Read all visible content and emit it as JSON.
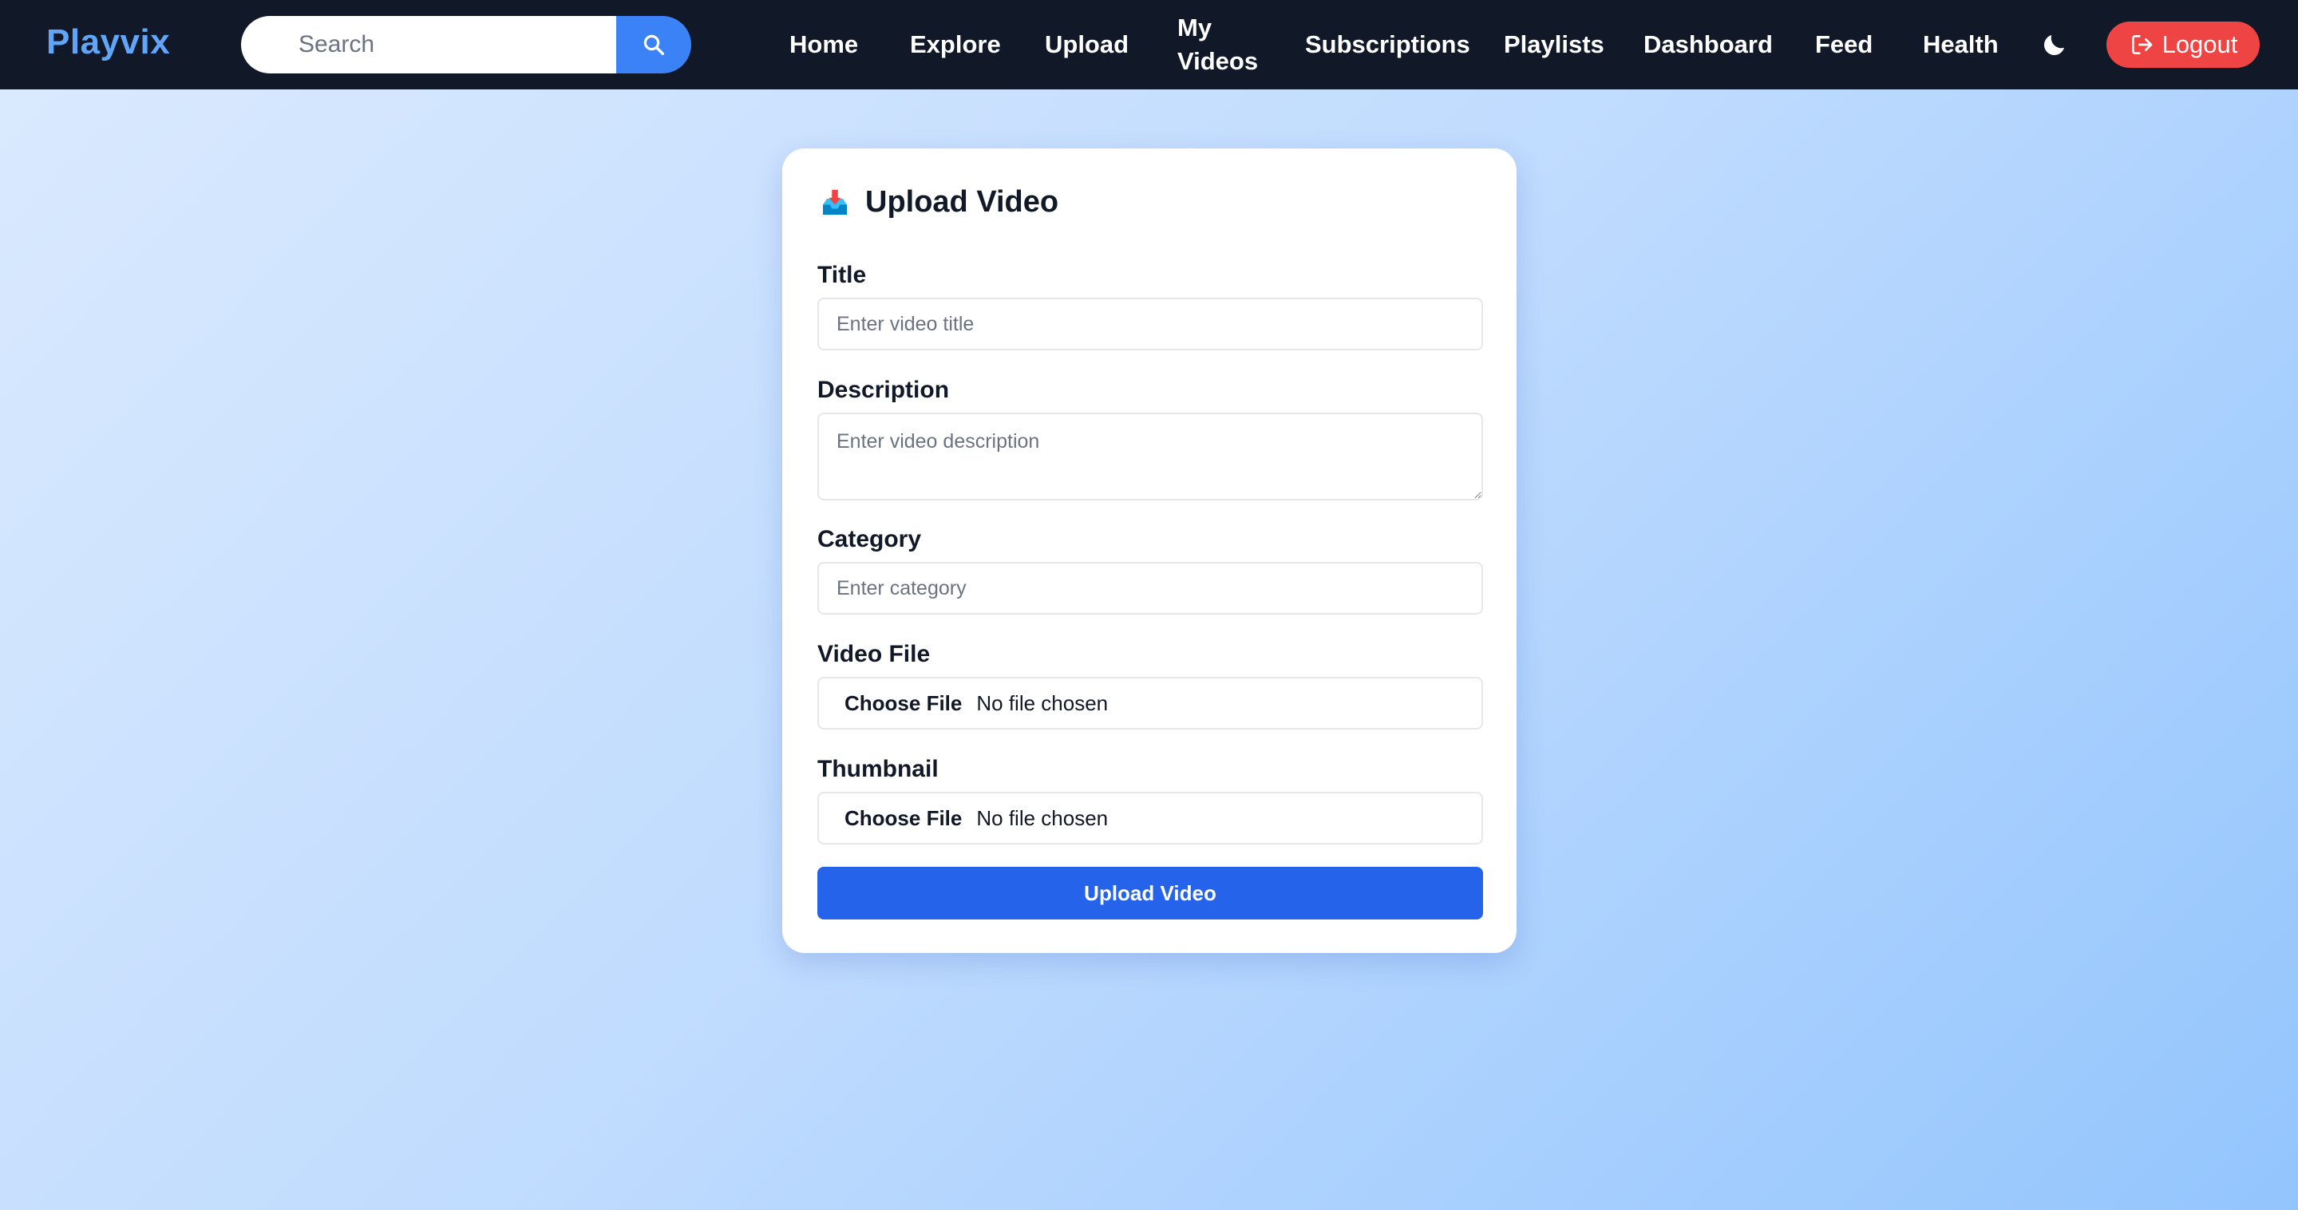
{
  "brand": "Playvix",
  "search": {
    "placeholder": "Search"
  },
  "nav": {
    "home": "Home",
    "explore": "Explore",
    "upload": "Upload",
    "my_videos_line1": "My",
    "my_videos_line2": "Videos",
    "subscriptions": "Subscriptions",
    "playlists": "Playlists",
    "dashboard": "Dashboard",
    "feed": "Feed",
    "health": "Health",
    "logout": "Logout"
  },
  "form": {
    "heading": "Upload Video",
    "title_label": "Title",
    "title_placeholder": "Enter video title",
    "description_label": "Description",
    "description_placeholder": "Enter video description",
    "category_label": "Category",
    "category_placeholder": "Enter category",
    "video_file_label": "Video File",
    "thumbnail_label": "Thumbnail",
    "choose_file": "Choose File",
    "no_file": "No file chosen",
    "submit": "Upload Video"
  },
  "colors": {
    "navbar": "#111827",
    "brand": "#60a5fa",
    "search_button": "#3b82f6",
    "logout": "#ef4444",
    "submit": "#2563eb"
  }
}
